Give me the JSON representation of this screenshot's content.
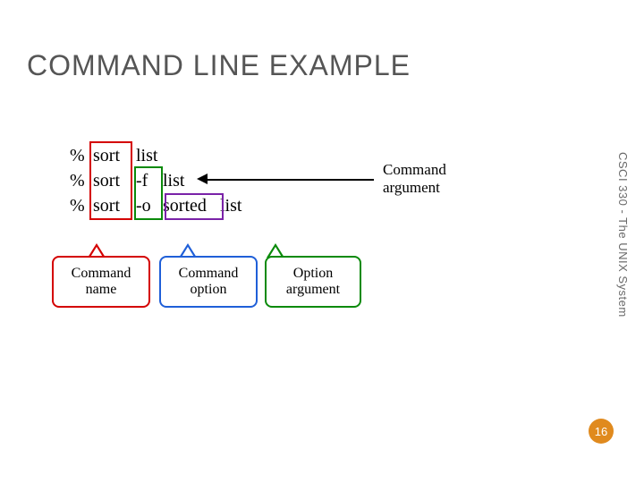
{
  "title": "COMMAND LINE EXAMPLE",
  "commands": {
    "r1": {
      "pct": "%",
      "cmd": "sort",
      "opt": "",
      "a1": "list",
      "a2": ""
    },
    "r2": {
      "pct": "%",
      "cmd": "sort",
      "opt": "-f",
      "a1": "list",
      "a2": ""
    },
    "r3": {
      "pct": "%",
      "cmd": "sort",
      "opt": "-o",
      "a1": "sorted",
      "a2": "list"
    }
  },
  "labels": {
    "command_argument": "Command\nargument",
    "command_name": "Command\nname",
    "command_option": "Command\noption",
    "option_argument": "Option\nargument"
  },
  "side_text": "CSCI 330 - The UNIX System",
  "page_number": "16"
}
